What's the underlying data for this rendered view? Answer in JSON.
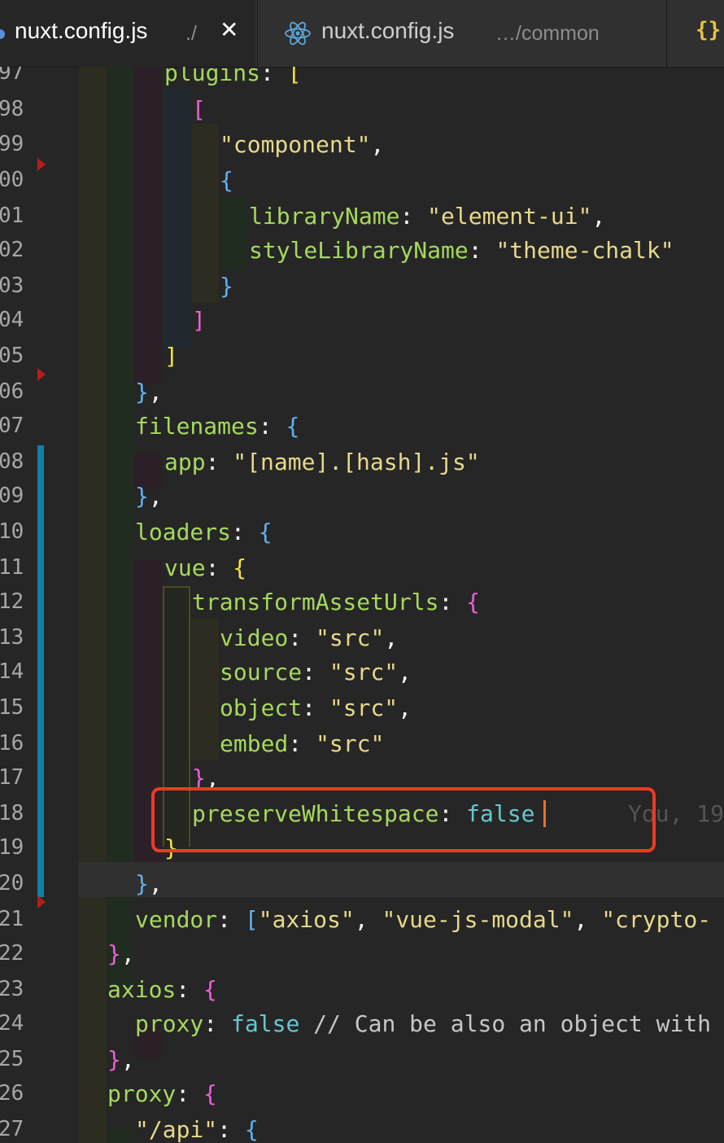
{
  "colors": {
    "editor_bg": "#262626",
    "tab_bar_bg": "#2f2f2f",
    "property_key": "#a6d95c",
    "string": "#e7d98b",
    "keyword": "#67c6cf",
    "bracket_level_1": "#f5e040",
    "bracket_level_2": "#ec5fd7",
    "bracket_level_3": "#5fb2f2",
    "modified_line_marker": "#0f81a8",
    "annotation_box": "#ed3a24",
    "cursor": "#e8702a"
  },
  "tabs": [
    {
      "title": "nuxt.config.js",
      "description": "./",
      "active": true,
      "close_glyph": "✕",
      "icon": "js-file-icon"
    },
    {
      "title": "nuxt.config.js",
      "description": "…/common",
      "active": false,
      "icon": "react-icon"
    },
    {
      "title": "",
      "description": "",
      "active": false,
      "icon": "json-braces-icon",
      "icon_glyph": "{}"
    }
  ],
  "line_numbers": [
    "97",
    "98",
    "99",
    "00",
    "01",
    "02",
    "03",
    "04",
    "05",
    "06",
    "07",
    "08",
    "09",
    "10",
    "11",
    "12",
    "13",
    "14",
    "15",
    "16",
    "17",
    "18",
    "19",
    "20",
    "21",
    "22",
    "23",
    "24",
    "25",
    "26",
    "27"
  ],
  "code": {
    "l97": {
      "key": "plugins",
      "colon": ": ",
      "bracket": "["
    },
    "l98": {
      "bracket": "["
    },
    "l99": {
      "string": "\"component\"",
      "comma": ","
    },
    "l100": {
      "bracket": "{"
    },
    "l101": {
      "key": "libraryName",
      "colon": ": ",
      "string": "\"element-ui\"",
      "comma": ","
    },
    "l102": {
      "key": "styleLibraryName",
      "colon": ": ",
      "string": "\"theme-chalk\""
    },
    "l103": {
      "bracket": "}"
    },
    "l104": {
      "bracket": "]"
    },
    "l105": {
      "bracket": "]"
    },
    "l106": {
      "bracket": "}",
      "comma": ","
    },
    "l107": {
      "key": "filenames",
      "colon": ": ",
      "bracket": "{"
    },
    "l108": {
      "key": "app",
      "colon": ": ",
      "string": "\"[name].[hash].js\""
    },
    "l109": {
      "bracket": "}",
      "comma": ","
    },
    "l110": {
      "key": "loaders",
      "colon": ": ",
      "bracket": "{"
    },
    "l111": {
      "key": "vue",
      "colon": ": ",
      "bracket": "{"
    },
    "l112": {
      "key": "transformAssetUrls",
      "colon": ": ",
      "bracket": "{"
    },
    "l113": {
      "key": "video",
      "colon": ": ",
      "string": "\"src\"",
      "comma": ","
    },
    "l114": {
      "key": "source",
      "colon": ": ",
      "string": "\"src\"",
      "comma": ","
    },
    "l115": {
      "key": "object",
      "colon": ": ",
      "string": "\"src\"",
      "comma": ","
    },
    "l116": {
      "key": "embed",
      "colon": ": ",
      "string": "\"src\""
    },
    "l117": {
      "bracket": "}",
      "comma": ","
    },
    "l118": {
      "key": "preserveWhitespace",
      "colon": ": ",
      "value": "false",
      "blame": "You, 19"
    },
    "l119": {
      "bracket": "}"
    },
    "l120": {
      "bracket": "}",
      "comma": ","
    },
    "l121": {
      "key": "vendor",
      "colon": ": ",
      "open": "[",
      "s1": "\"axios\"",
      "sep1": ", ",
      "s2": "\"vue-js-modal\"",
      "sep2": ", ",
      "s3": "\"crypto-"
    },
    "l122": {
      "bracket": "}",
      "comma": ","
    },
    "l123": {
      "key": "axios",
      "colon": ": ",
      "bracket": "{"
    },
    "l124": {
      "key": "proxy",
      "colon": ": ",
      "value": "false",
      "comment": " // Can be also an object with"
    },
    "l125": {
      "bracket": "}",
      "comma": ","
    },
    "l126": {
      "key": "proxy",
      "colon": ": ",
      "bracket": "{"
    },
    "l127": {
      "string": "\"/api\"",
      "colon": ": ",
      "bracket": "{"
    }
  }
}
